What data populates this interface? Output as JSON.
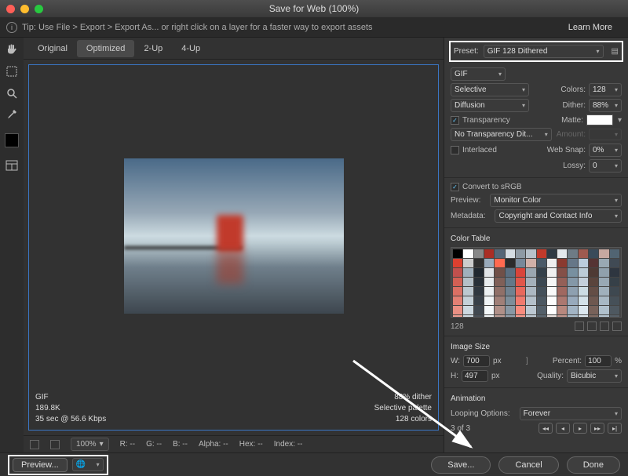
{
  "window": {
    "title": "Save for Web (100%)"
  },
  "tipbar": {
    "text": "Tip: Use File > Export > Export As...  or right click on a layer for a faster way to export assets",
    "learn_more": "Learn More"
  },
  "tabs": {
    "items": [
      "Original",
      "Optimized",
      "2-Up",
      "4-Up"
    ],
    "active_index": 1
  },
  "preview_info_left": {
    "format": "GIF",
    "size": "189.8K",
    "time": "35 sec @ 56.6 Kbps"
  },
  "preview_info_right": {
    "dither": "88% dither",
    "palette": "Selective palette",
    "colors": "128 colors"
  },
  "status": {
    "zoom": "100%",
    "R": "R: --",
    "G": "G: --",
    "B": "B: --",
    "Alpha": "Alpha: --",
    "Hex": "Hex: --",
    "Index": "Index: --"
  },
  "right": {
    "preset_label": "Preset:",
    "preset_value": "GIF 128 Dithered",
    "format": "GIF",
    "reduction": "Selective",
    "colors_label": "Colors:",
    "colors": "128",
    "dither_method": "Diffusion",
    "dither_label": "Dither:",
    "dither_amount": "88%",
    "transparency_label": "Transparency",
    "matte_label": "Matte:",
    "trans_dither": "No Transparency Dit...",
    "amount_label": "Amount:",
    "interlaced_label": "Interlaced",
    "web_snap_label": "Web Snap:",
    "web_snap": "0%",
    "lossy_label": "Lossy:",
    "lossy": "0",
    "convert_srgb_label": "Convert to sRGB",
    "preview_label": "Preview:",
    "preview_value": "Monitor Color",
    "metadata_label": "Metadata:",
    "metadata_value": "Copyright and Contact Info",
    "color_table_label": "Color Table",
    "color_table_count": "128",
    "image_size_label": "Image Size",
    "W_label": "W:",
    "W": "700",
    "px": "px",
    "H_label": "H:",
    "H": "497",
    "percent_label": "Percent:",
    "percent": "100",
    "percent_sym": "%",
    "quality_label": "Quality:",
    "quality": "Bicubic",
    "animation_label": "Animation",
    "looping_label": "Looping Options:",
    "looping": "Forever",
    "frame_of": "3 of 3"
  },
  "footer": {
    "preview": "Preview...",
    "save": "Save...",
    "cancel": "Cancel",
    "done": "Done"
  },
  "color_table_swatches": [
    "#000000",
    "#ffffff",
    "#888888",
    "#aa2e25",
    "#556677",
    "#d5dde3",
    "#8e9aa4",
    "#b8c2ca",
    "#c13a2b",
    "#2f3a44",
    "#e3e8ec",
    "#6e7b85",
    "#9e5a50",
    "#3a4b5a",
    "#c6a8a0",
    "#516472",
    "#dd4030",
    "#cccccc",
    "#303030",
    "#99aabb",
    "#ff6a50",
    "#2b2b2b",
    "#778899",
    "#d0b0a8",
    "#4a5a68",
    "#eeeeee",
    "#8a3a30",
    "#667788",
    "#bbccdd",
    "#553333",
    "#99a8b2",
    "#404a54",
    "#c0504d",
    "#a0b0bc",
    "#202830",
    "#e0e4e8",
    "#705048",
    "#5a6e80",
    "#d8443a",
    "#9aa6b0",
    "#34404a",
    "#f0f0f0",
    "#845048",
    "#7890a0",
    "#bcccd8",
    "#4e3a34",
    "#90a0ac",
    "#2e3640",
    "#d26054",
    "#b4c0c8",
    "#283038",
    "#e8ecee",
    "#806058",
    "#647888",
    "#e0564a",
    "#a4b0ba",
    "#3c4852",
    "#f6f6f6",
    "#946058",
    "#8498a8",
    "#c4d0dc",
    "#5a443c",
    "#98a8b4",
    "#364048",
    "#da7064",
    "#bcc8d0",
    "#303840",
    "#ecf0f2",
    "#907068",
    "#708290",
    "#e8685c",
    "#acb8c2",
    "#44505a",
    "#fafafa",
    "#a06860",
    "#8ea0b0",
    "#ccdce4",
    "#644e46",
    "#a0b0bc",
    "#3e4850",
    "#e28074",
    "#c4d0d8",
    "#384048",
    "#f0f4f6",
    "#a08078",
    "#7c8e9a",
    "#f07a6e",
    "#b4c0ca",
    "#4c5862",
    "#fdfdfd",
    "#ac7870",
    "#98aabc",
    "#d4e2ea",
    "#6e5850",
    "#a8b8c4",
    "#465058",
    "#ea9084",
    "#ccd8e0",
    "#404850",
    "#f4f8fa",
    "#b09088",
    "#8898a4",
    "#f88c7e",
    "#bcc8d2",
    "#54606a",
    "#ffffff",
    "#b8887e",
    "#a2b4c4",
    "#dce8f0",
    "#78625a",
    "#b0c0cc",
    "#4e5860",
    "#f2a094",
    "#d4e0e8",
    "#485058",
    "#f8fcfe",
    "#c0a098",
    "#94a2ae",
    "#ff9e90",
    "#c4d0da",
    "#5c6872",
    "#f0e8e4",
    "#c49890",
    "#acc0ce",
    "#e4eef6",
    "#826c64",
    "#b8c8d4",
    "#566068"
  ]
}
